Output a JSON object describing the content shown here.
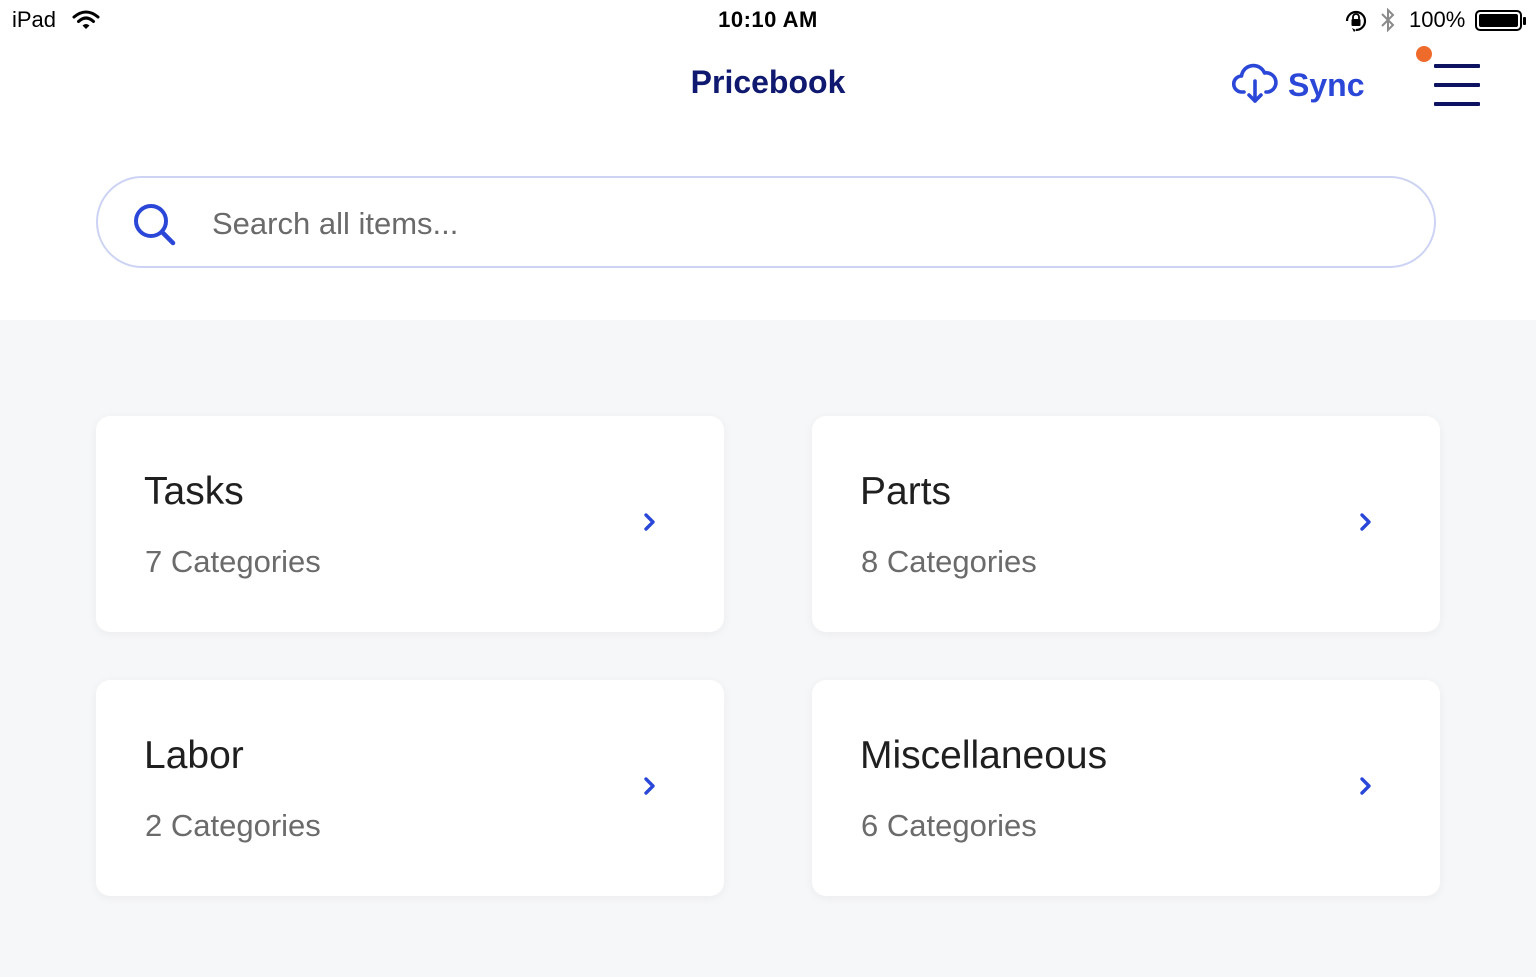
{
  "status_bar": {
    "device": "iPad",
    "time": "10:10 AM",
    "battery": "100%",
    "icons": [
      "wifi-icon",
      "orientation-lock-icon",
      "bluetooth-icon",
      "battery-icon"
    ]
  },
  "nav": {
    "title": "Pricebook",
    "sync_label": "Sync",
    "sync_icon": "cloud-download-icon",
    "menu_icon": "hamburger-menu-icon",
    "notification_color": "#ef6b2c"
  },
  "search": {
    "placeholder": "Search all items...",
    "value": "",
    "icon": "search-icon"
  },
  "categories": [
    {
      "title": "Tasks",
      "subtitle": "7 Categories"
    },
    {
      "title": "Parts",
      "subtitle": "8 Categories"
    },
    {
      "title": "Labor",
      "subtitle": "2 Categories"
    },
    {
      "title": "Miscellaneous",
      "subtitle": "6 Categories"
    }
  ],
  "colors": {
    "accent": "#2b47d8",
    "title": "#101970",
    "background": "#f6f7f9"
  }
}
